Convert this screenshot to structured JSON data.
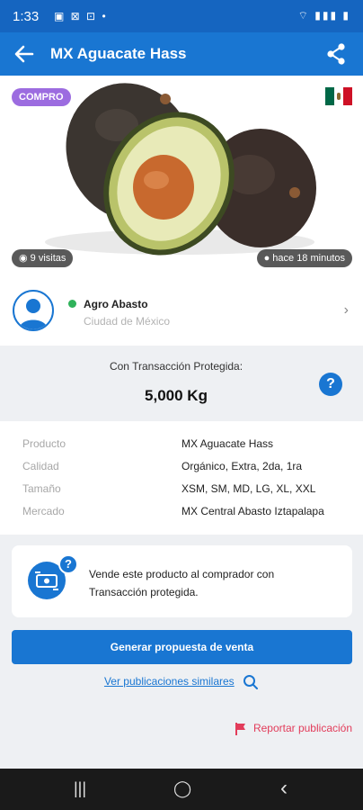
{
  "status_bar": {
    "time": "1:33",
    "left_icons": "▣ ⊠ ⊡ •",
    "right_icons": "⌔ ▮▮▮ ▮"
  },
  "app_bar": {
    "title": "MX Aguacate Hass"
  },
  "listing": {
    "badge": "COMPRO",
    "country": "mx-flag",
    "views": "9 visitas",
    "posted": "hace 18 minutos"
  },
  "seller": {
    "name": "Agro Abasto",
    "location": "Ciudad de México"
  },
  "transaction": {
    "label": "Con Transacción Protegida:",
    "quantity": "5,000 Kg",
    "help": "?"
  },
  "details": [
    {
      "key": "Producto",
      "value": "MX Aguacate Hass"
    },
    {
      "key": "Calidad",
      "value": "Orgánico, Extra, 2da, 1ra"
    },
    {
      "key": "Tamaño",
      "value": "XSM, SM, MD, LG, XL, XXL"
    },
    {
      "key": "Mercado",
      "value": "MX Central Abasto Iztapalapa"
    }
  ],
  "info_card": {
    "text": "Vende este producto al comprador con Transacción protegida.",
    "help": "?"
  },
  "cta_label": "Generar propuesta de venta",
  "similar_link": "Ver publicaciones similares",
  "report_link": "Reportar publicación",
  "nav": {
    "recent": "|||",
    "home": "◯",
    "back": "‹"
  },
  "colors": {
    "primary": "#1976d2",
    "status_bar": "#1565c0",
    "badge": "#9c6ce0",
    "report": "#e23c5a",
    "online": "#2fb25a"
  }
}
